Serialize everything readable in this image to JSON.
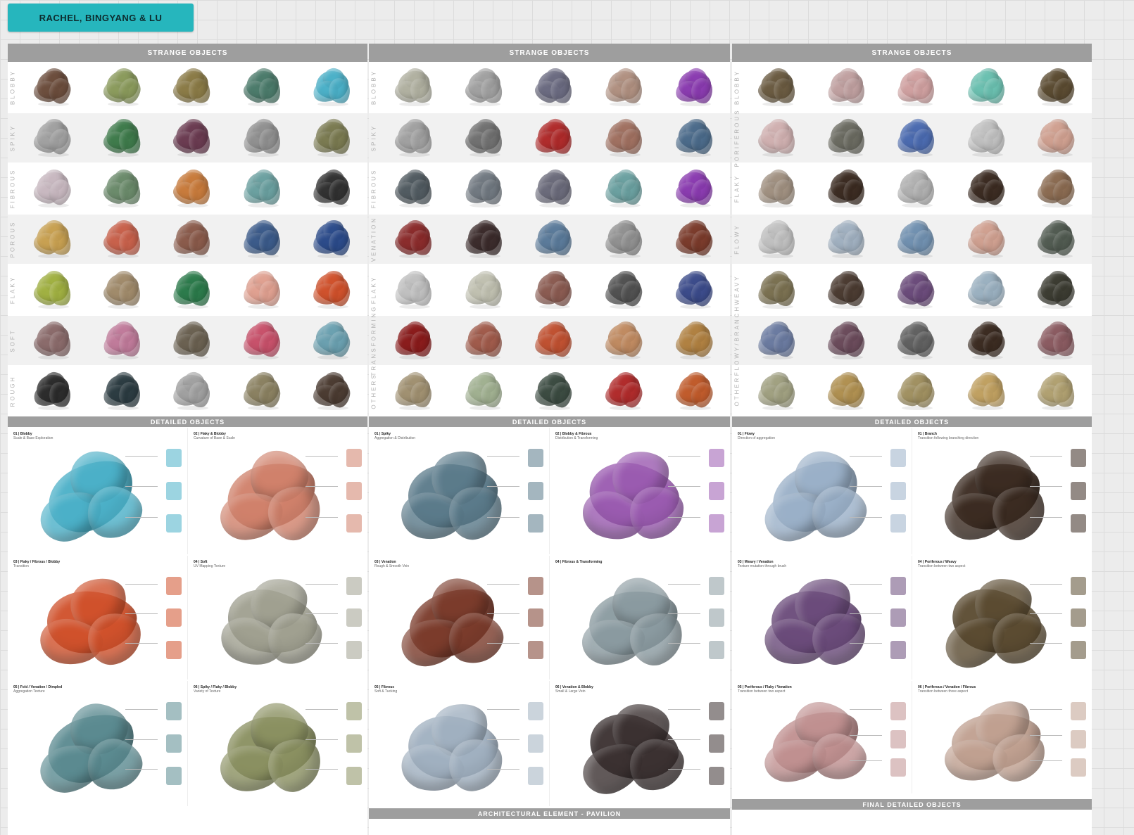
{
  "title_tag": "RACHEL, BINGYANG & LU",
  "boards": [
    {
      "banner": "STRANGE OBJECTS",
      "rows": [
        {
          "label": "BLOBBY",
          "colors": [
            "#6b4c3b",
            "#8a9a5b",
            "#8a7a45",
            "#4a7a6a",
            "#4ab0c8"
          ]
        },
        {
          "label": "SPIKY",
          "colors": [
            "#a0a0a0",
            "#3d7a4a",
            "#6a3a50",
            "#909090",
            "#7a7a50"
          ]
        },
        {
          "label": "FIBROUS",
          "colors": [
            "#c8b8c0",
            "#6a8a6a",
            "#c87a3a",
            "#6aa0a0",
            "#303030"
          ]
        },
        {
          "label": "POROUS",
          "colors": [
            "#c8a050",
            "#c8604a",
            "#8a5a4a",
            "#3a5a8a",
            "#2a4a8a"
          ]
        },
        {
          "label": "FLAKY",
          "colors": [
            "#a0b040",
            "#a08a6a",
            "#2a7a4a",
            "#e0a090",
            "#d0502a"
          ]
        },
        {
          "label": "SOFT",
          "colors": [
            "#8a6a6a",
            "#c07a9a",
            "#6a6050",
            "#c8506a",
            "#6aa0b0"
          ]
        },
        {
          "label": "ROUGH",
          "colors": [
            "#2a2a2a",
            "#2a3a40",
            "#a0a0a0",
            "#8a8060",
            "#4a3a30"
          ]
        }
      ]
    },
    {
      "banner": "STRANGE OBJECTS",
      "rows": [
        {
          "label": "BLOBBY",
          "colors": [
            "#b0b0a0",
            "#a0a0a0",
            "#6a6a80",
            "#b09080",
            "#8a3ab0"
          ]
        },
        {
          "label": "SPIKY",
          "colors": [
            "#a0a0a0",
            "#707070",
            "#b02a2a",
            "#a07060",
            "#4a6a8a"
          ]
        },
        {
          "label": "FIBROUS",
          "colors": [
            "#505a60",
            "#707880",
            "#6a6a7a",
            "#6aa0a0",
            "#8a3ab0"
          ]
        },
        {
          "label": "VENATION",
          "colors": [
            "#8a2a2a",
            "#3a2a2a",
            "#5a7a9a",
            "#909090",
            "#7a3a2a"
          ]
        },
        {
          "label": "FLAKY",
          "colors": [
            "#c0c0c0",
            "#c0c0b0",
            "#8a5a50",
            "#505050",
            "#3a4a8a"
          ]
        },
        {
          "label": "TRANSFORMING",
          "colors": [
            "#8a1a1a",
            "#a05a4a",
            "#c05030",
            "#c08a60",
            "#b08040"
          ]
        },
        {
          "label": "OTHERS",
          "colors": [
            "#a09070",
            "#a0b090",
            "#3a4a40",
            "#b02a2a",
            "#c05a2a"
          ]
        }
      ]
    },
    {
      "banner": "STRANGE OBJECTS",
      "rows": [
        {
          "label": "BLOBBY",
          "colors": [
            "#6a5a40",
            "#c0a0a0",
            "#d0a0a0",
            "#6ac0b0",
            "#5a4a30"
          ]
        },
        {
          "label": "PORIFEROUS",
          "colors": [
            "#d0b0b0",
            "#6a6a60",
            "#4a6ab0",
            "#c0c0c0",
            "#d0a090"
          ]
        },
        {
          "label": "FLAKY",
          "colors": [
            "#a09080",
            "#3a2a20",
            "#b0b0b0",
            "#3a2a20",
            "#8a6a50"
          ]
        },
        {
          "label": "FLOWY",
          "colors": [
            "#c0c0c0",
            "#a0b0c0",
            "#7090b0",
            "#d0a090",
            "#505a50"
          ]
        },
        {
          "label": "WEAVY",
          "colors": [
            "#7a7050",
            "#4a3a30",
            "#6a4a7a",
            "#9ab0c0",
            "#3a3a30"
          ]
        },
        {
          "label": "FLOWY/BRANCH",
          "colors": [
            "#6a7aa0",
            "#6a4a5a",
            "#606060",
            "#3a2a20",
            "#8a5a60"
          ]
        },
        {
          "label": "OTHER",
          "colors": [
            "#a0a080",
            "#b09050",
            "#a09060",
            "#c0a060",
            "#b0a070"
          ]
        }
      ]
    }
  ],
  "detailed_banner": "DETAILED OBJECTS",
  "final_banner": "FINAL DETAILED OBJECTS",
  "bottom_banner": "ARCHITECTURAL ELEMENT - PAVILION",
  "details": [
    {
      "title": "01 | Blobby",
      "sub": "Scale & Base Exploration",
      "color": "#4ab0c8"
    },
    {
      "title": "02 | Flaky & Blobby",
      "sub": "Curvature of Base & Scale",
      "color": "#d0806a"
    },
    {
      "title": "01 | Spiky",
      "sub": "Aggregation & Distribution",
      "color": "#5a7a8a"
    },
    {
      "title": "02 | Blobby & Fibrous",
      "sub": "Distribution & Transforming",
      "color": "#9a5ab0"
    },
    {
      "title": "01 | Flowy",
      "sub": "Direction of aggregation",
      "color": "#9ab0c8"
    },
    {
      "title": "01 | Branch",
      "sub": "Transition following branching direction",
      "color": "#3a2a20"
    },
    {
      "title": "03 | Flaky / Fibrous / Blobby",
      "sub": "Transition",
      "color": "#d0502a"
    },
    {
      "title": "04 | Soft",
      "sub": "UV Mapping Texture",
      "color": "#a0a090"
    },
    {
      "title": "03 | Venation",
      "sub": "Rough & Smooth Vein",
      "color": "#7a3a2a"
    },
    {
      "title": "04 | Fibrous & Transforming",
      "sub": "",
      "color": "#8a9aa0"
    },
    {
      "title": "03 | Weavy / Venation",
      "sub": "Texture mutation through brush",
      "color": "#6a4a7a"
    },
    {
      "title": "04 | Poriferous / Weavy",
      "sub": "Transition between two aspect",
      "color": "#5a4a30"
    },
    {
      "title": "05 | Fold / Venation / Dimpled",
      "sub": "Aggregation Texture",
      "color": "#5a8a90"
    },
    {
      "title": "06 | Spiky / Flaky / Blobby",
      "sub": "Variety of Texture",
      "color": "#8a9060"
    },
    {
      "title": "05 | Fibrous",
      "sub": "Soft & Tucking",
      "color": "#a0b0c0"
    },
    {
      "title": "06 | Venation & Blobby",
      "sub": "Small & Large Vein",
      "color": "#3a3030"
    },
    {
      "title": "05 | Poriferous / Flaky / Venation",
      "sub": "Transition between two aspect",
      "color": "#c09090"
    },
    {
      "title": "06 | Poriferous / Venation / Fibrous",
      "sub": "Transition between three aspect",
      "color": "#c0a090"
    }
  ]
}
